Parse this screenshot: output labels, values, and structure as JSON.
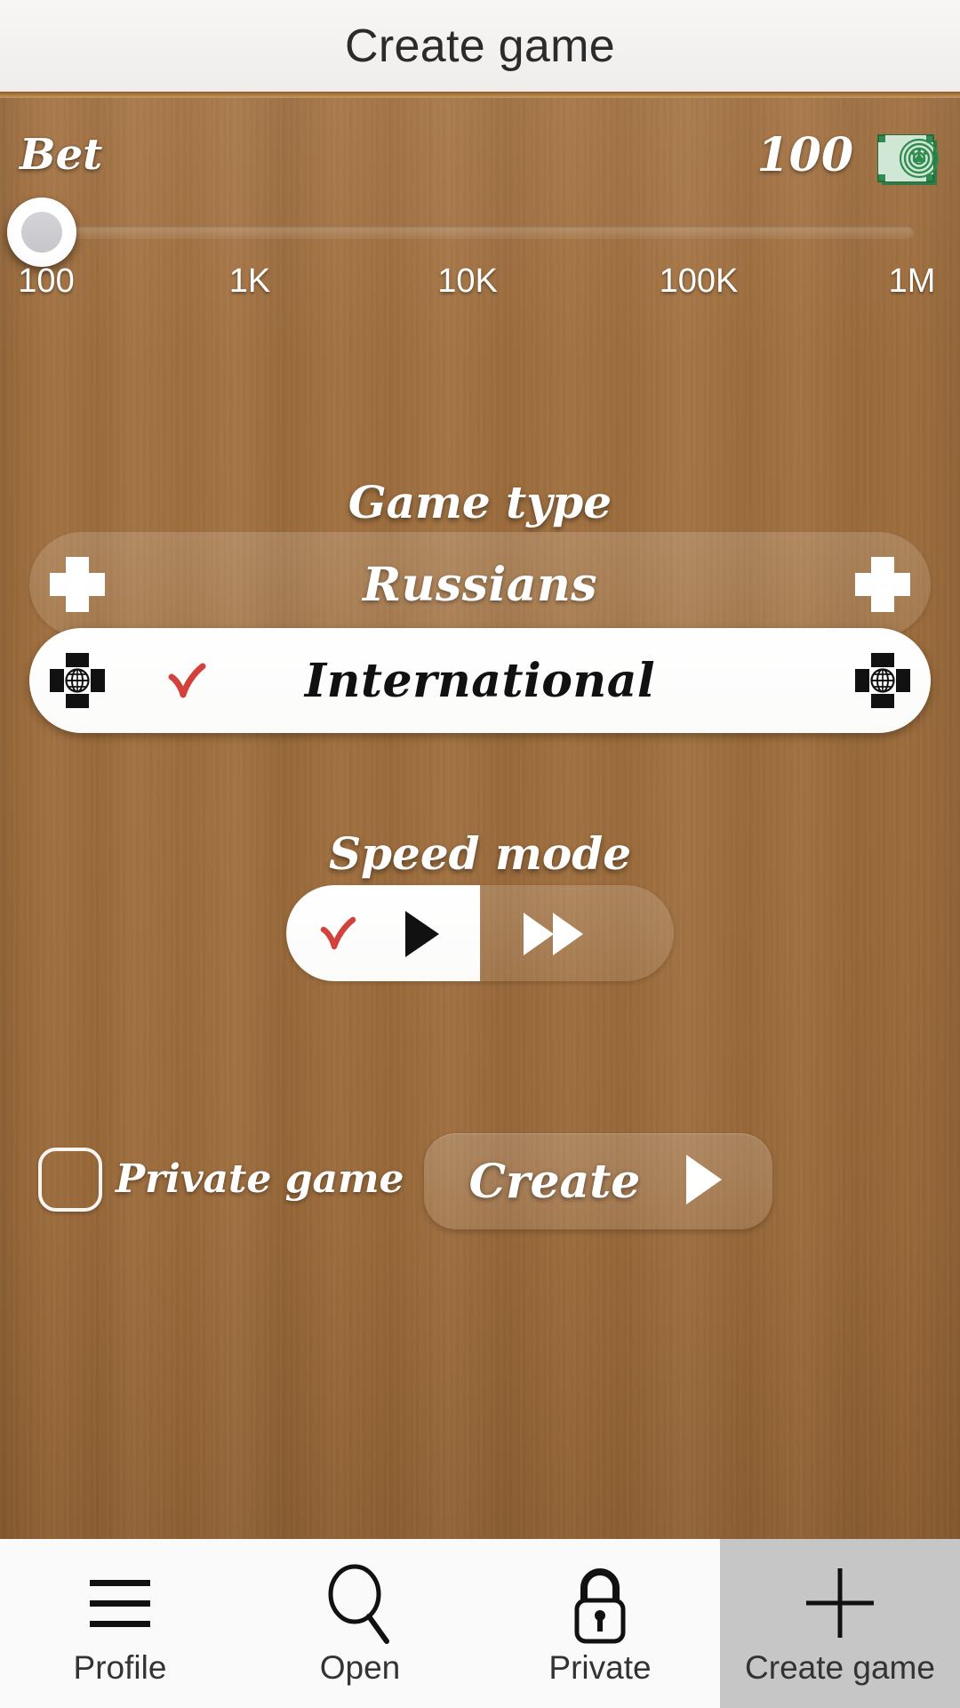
{
  "header": {
    "title": "Create game"
  },
  "bet": {
    "label": "Bet",
    "value": "100",
    "money_icon": "banknote-icon",
    "slider": {
      "handle_position_percent": 0,
      "ticks": [
        "100",
        "1K",
        "10K",
        "100K",
        "1M"
      ]
    }
  },
  "game_type": {
    "title": "Game type",
    "options": [
      {
        "label": "Russians",
        "icon": "ru-flag-icon",
        "selected": false
      },
      {
        "label": "International",
        "icon": "globe-icon",
        "selected": true
      }
    ]
  },
  "speed_mode": {
    "title": "Speed mode",
    "options": [
      {
        "icon": "play-icon",
        "selected": true
      },
      {
        "icon": "fast-forward-icon",
        "selected": false
      }
    ]
  },
  "private_game": {
    "label": "Private game",
    "checked": false
  },
  "create_button": {
    "label": "Create",
    "icon": "play-arrow-icon"
  },
  "navbar": {
    "items": [
      {
        "label": "Profile",
        "icon": "hamburger-icon",
        "active": false
      },
      {
        "label": "Open",
        "icon": "search-icon",
        "active": false
      },
      {
        "label": "Private",
        "icon": "lock-icon",
        "active": false
      },
      {
        "label": "Create game",
        "icon": "plus-icon",
        "active": true
      }
    ]
  },
  "colors": {
    "wood": "#9f6e3d",
    "accent_check": "#d2413c",
    "money_green": "#2f8b4f",
    "nav_active": "#c6c6c6"
  }
}
